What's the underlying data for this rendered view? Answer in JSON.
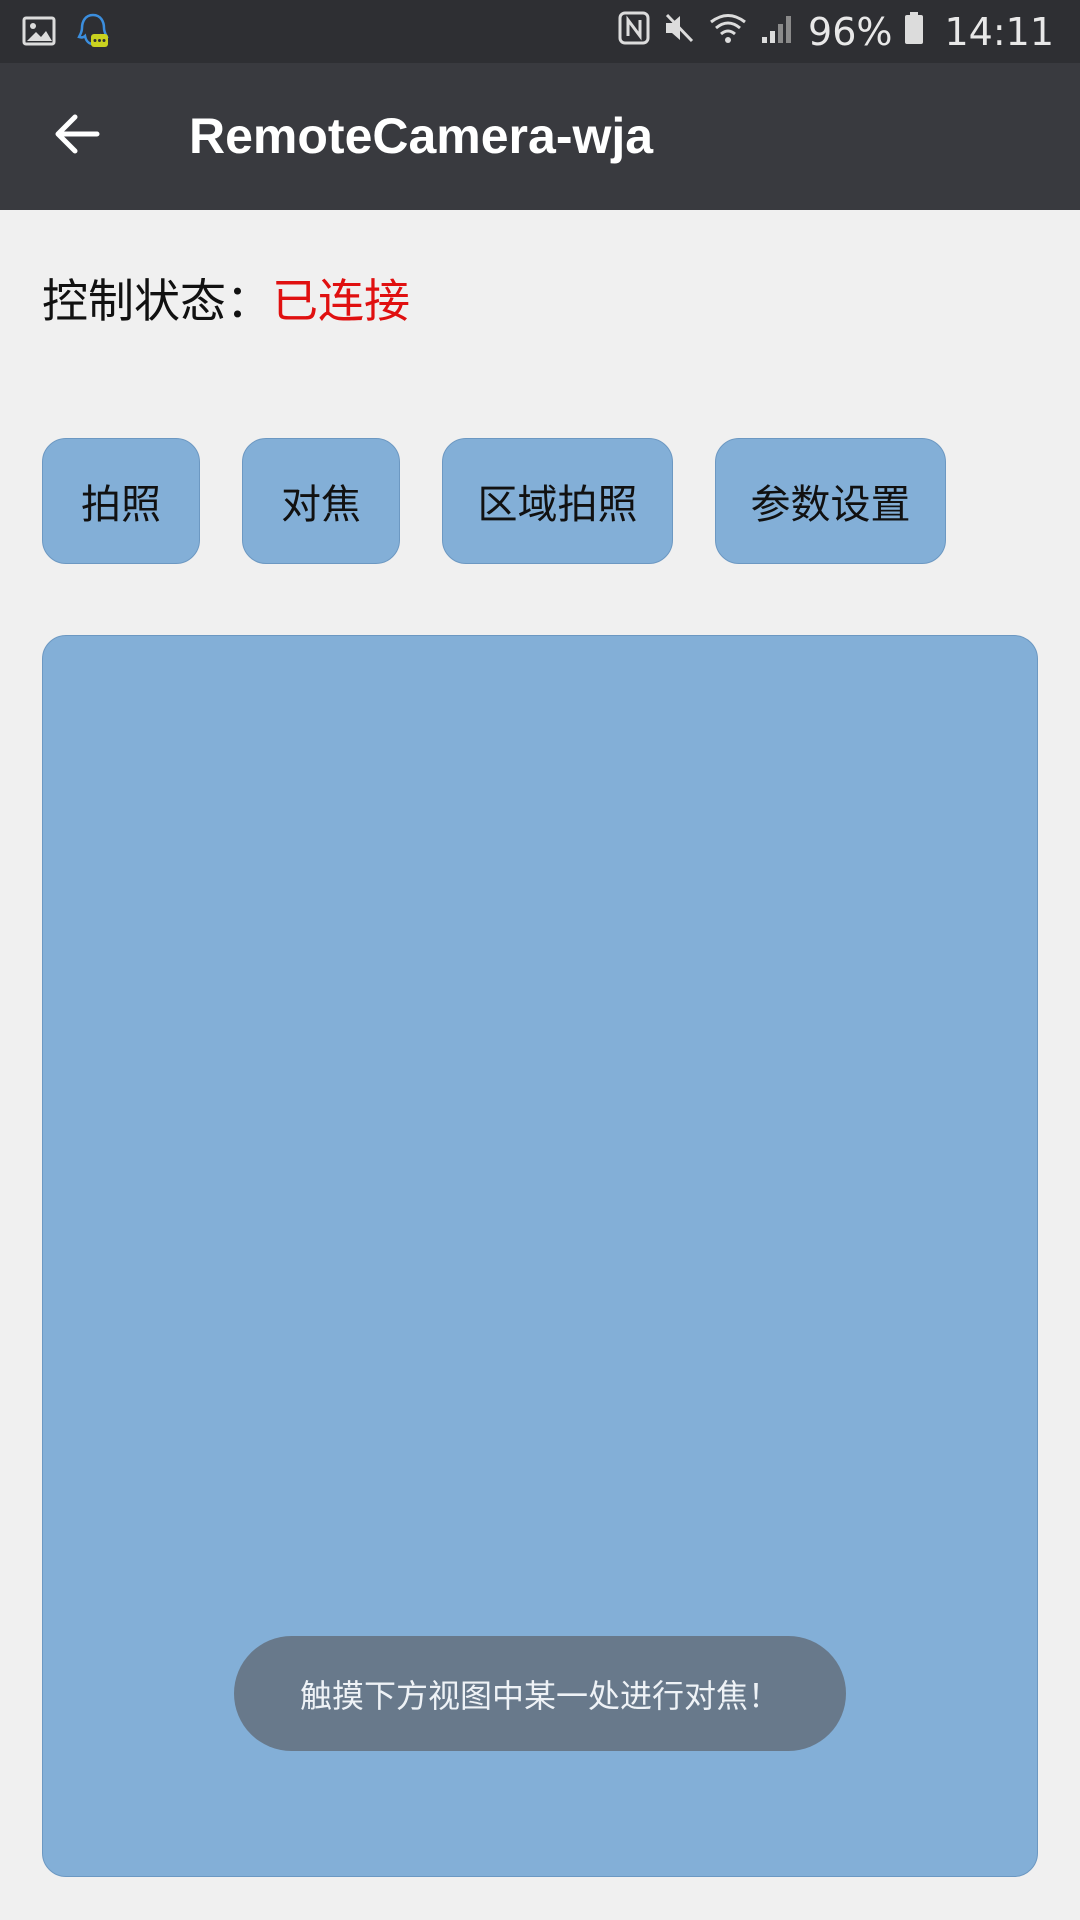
{
  "status_bar": {
    "left_icons": [
      "image-icon",
      "qq-chat-notification-icon"
    ],
    "right_icons": [
      "nfc-icon",
      "mute-icon",
      "wifi-icon",
      "signal-icon",
      "battery-icon"
    ],
    "battery": "96%",
    "time": "14:11"
  },
  "app_bar": {
    "back_icon": "arrow-back-icon",
    "title": "RemoteCamera-wja"
  },
  "control_status": {
    "label": "控制状态：",
    "value": "已连接",
    "value_color": "#e01010"
  },
  "buttons": {
    "take_photo": "拍照",
    "focus": "对焦",
    "region_photo": "区域拍照",
    "settings": "参数设置"
  },
  "toast": {
    "message": "触摸下方视图中某一处进行对焦！"
  },
  "colors": {
    "status_bar": "#2e2f33",
    "app_bar": "#393a3f",
    "background": "#f0f0f0",
    "accent_blue": "#83afd7",
    "toast": "#68798b"
  }
}
